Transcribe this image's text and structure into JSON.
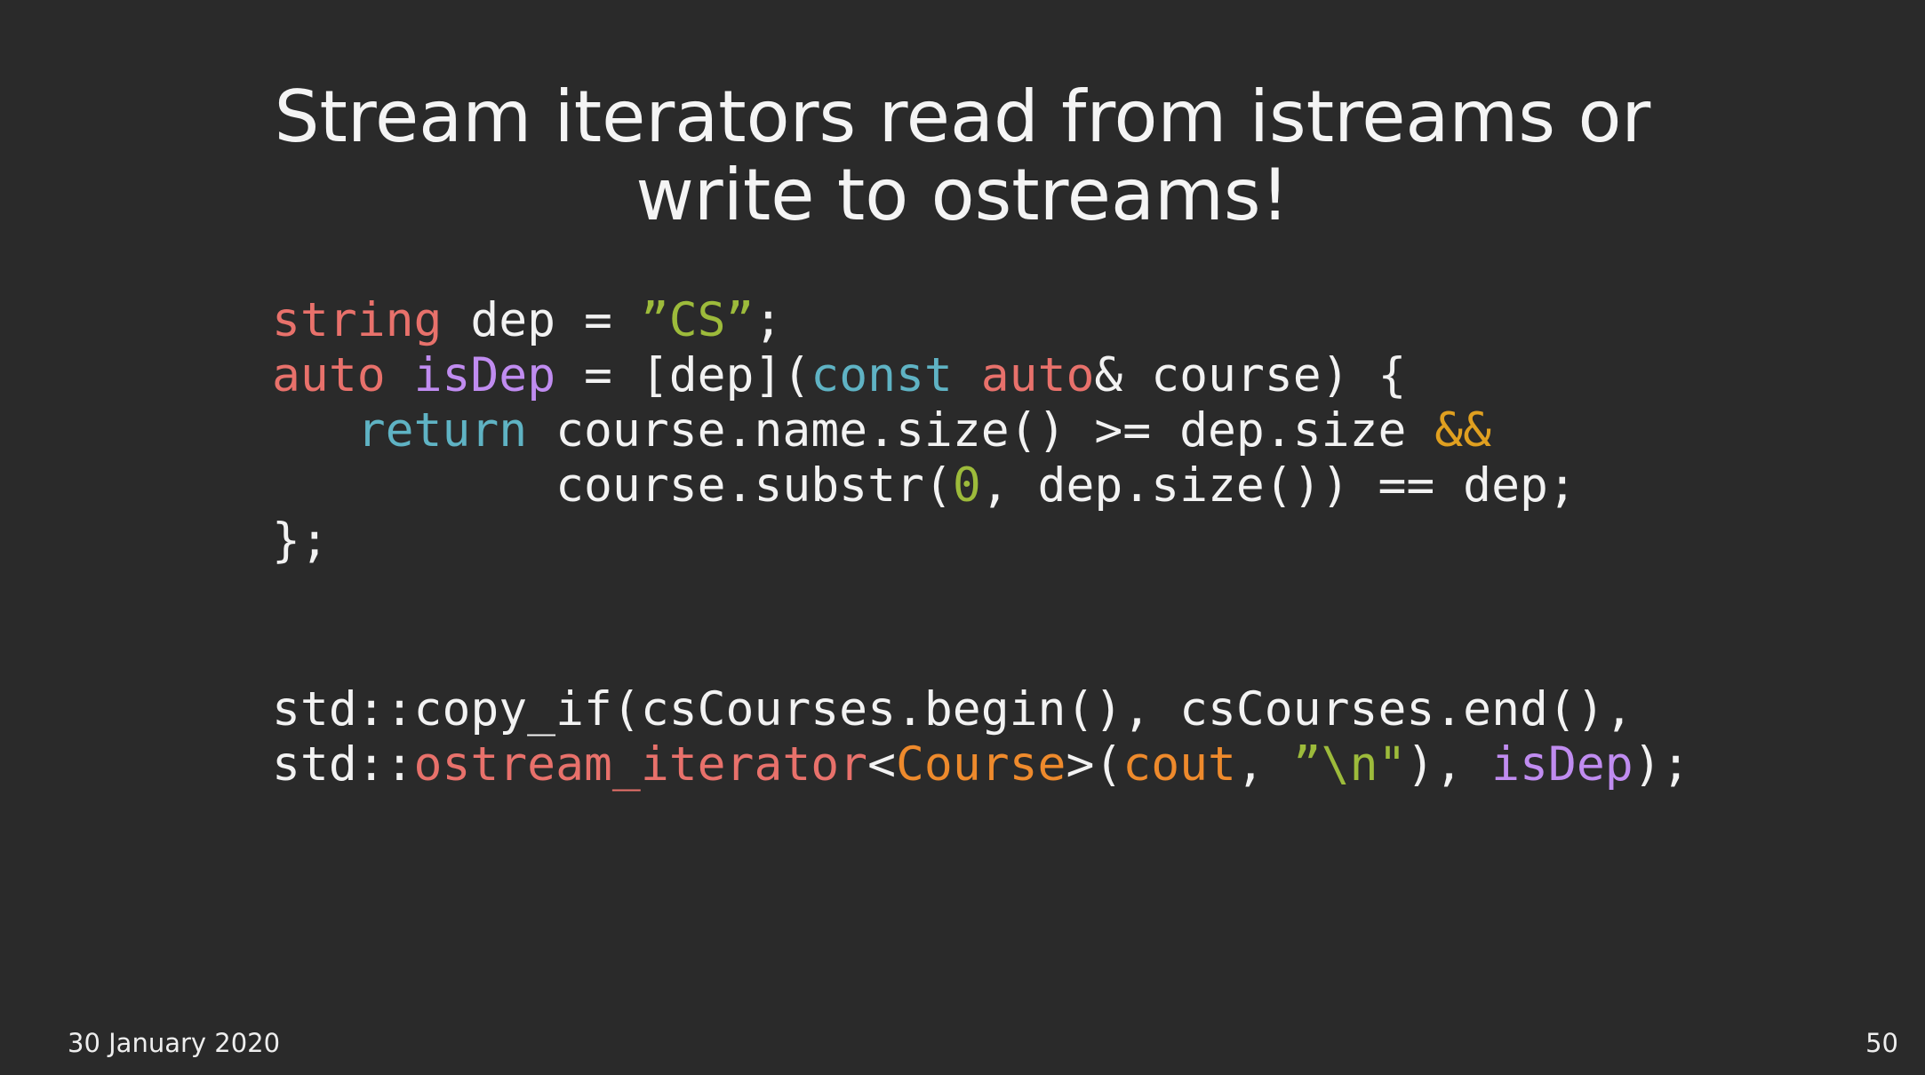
{
  "slide": {
    "title_lines": [
      "Stream iterators read from istreams or",
      "write to ostreams!"
    ],
    "date": "30 January 2020",
    "page_number": "50"
  },
  "colors": {
    "background": "#2a2a2a",
    "plain": "#f2f2f2",
    "type": "#e8716b",
    "function": "#c08cf0",
    "keyword": "#5fb3c4",
    "string": "#9dbb3b",
    "number": "#9dbb3b",
    "operator": "#e0a020",
    "variable": "#ee8a2c"
  },
  "code_block_1": [
    [
      {
        "text": "string",
        "kind": "type"
      },
      {
        "text": " dep = ",
        "kind": "plain"
      },
      {
        "text": "”CS”",
        "kind": "string"
      },
      {
        "text": ";",
        "kind": "plain"
      }
    ],
    [
      {
        "text": "auto",
        "kind": "type"
      },
      {
        "text": " ",
        "kind": "plain"
      },
      {
        "text": "isDep",
        "kind": "function"
      },
      {
        "text": " = [dep](",
        "kind": "plain"
      },
      {
        "text": "const",
        "kind": "keyword"
      },
      {
        "text": " ",
        "kind": "plain"
      },
      {
        "text": "auto",
        "kind": "type"
      },
      {
        "text": "& course) {",
        "kind": "plain"
      }
    ],
    [
      {
        "text": "   ",
        "kind": "plain"
      },
      {
        "text": "return",
        "kind": "keyword"
      },
      {
        "text": " course.name.size() >= dep.size ",
        "kind": "plain"
      },
      {
        "text": "&&",
        "kind": "operator"
      }
    ],
    [
      {
        "text": "          course.substr(",
        "kind": "plain"
      },
      {
        "text": "0",
        "kind": "number"
      },
      {
        "text": ", dep.size()) == dep;",
        "kind": "plain"
      }
    ],
    [
      {
        "text": "};",
        "kind": "plain"
      }
    ]
  ],
  "code_block_2": [
    [
      {
        "text": "std::copy_if(csCourses.begin(), csCourses.end(),",
        "kind": "plain"
      }
    ],
    [
      {
        "text": "std::",
        "kind": "plain"
      },
      {
        "text": "ostream_iterator",
        "kind": "type"
      },
      {
        "text": "<",
        "kind": "plain"
      },
      {
        "text": "Course",
        "kind": "variable"
      },
      {
        "text": ">(",
        "kind": "plain"
      },
      {
        "text": "cout",
        "kind": "variable"
      },
      {
        "text": ", ",
        "kind": "plain"
      },
      {
        "text": "”\\n\"",
        "kind": "string"
      },
      {
        "text": "), ",
        "kind": "plain"
      },
      {
        "text": "isDep",
        "kind": "function"
      },
      {
        "text": ");",
        "kind": "plain"
      }
    ]
  ]
}
